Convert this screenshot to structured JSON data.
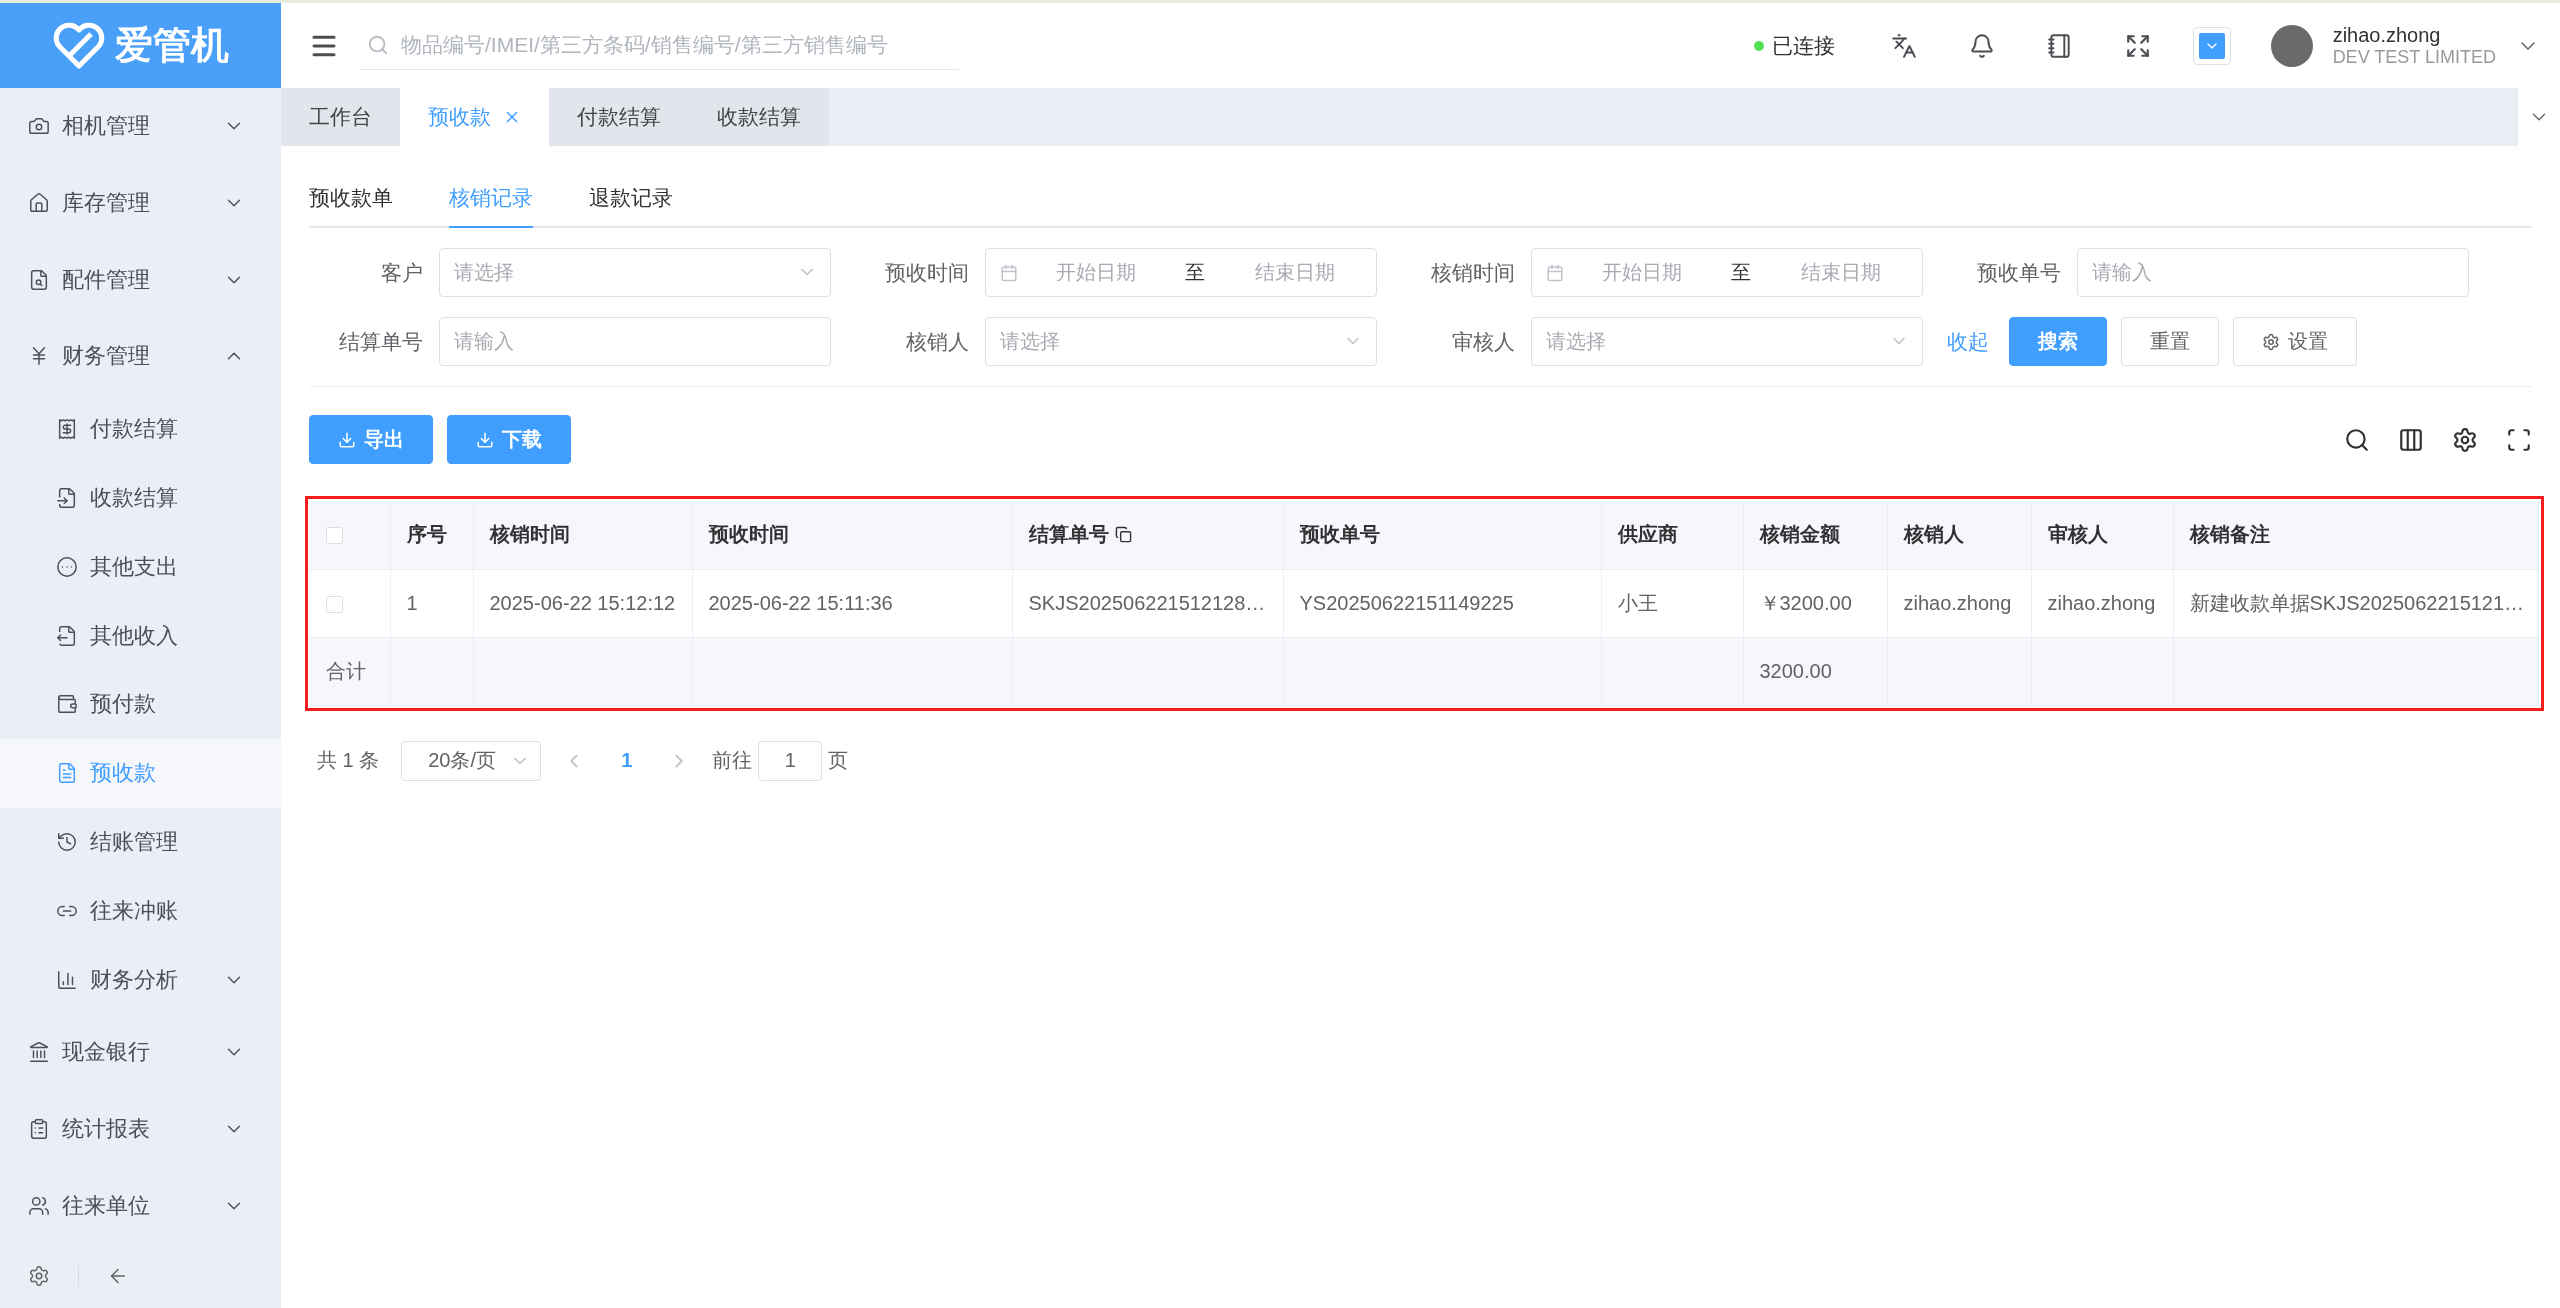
{
  "brand": {
    "name": "爱管机"
  },
  "search": {
    "placeholder": "物品编号/IMEI/第三方条码/销售编号/第三方销售编号"
  },
  "connection": {
    "label": "已连接",
    "connected": true
  },
  "user": {
    "name": "zihao.zhong",
    "company": "DEV TEST LIMITED"
  },
  "page_tabs": [
    {
      "label": "工作台",
      "selected": false,
      "closable": false
    },
    {
      "label": "预收款",
      "selected": true,
      "closable": true
    },
    {
      "label": "付款结算",
      "selected": false,
      "closable": false
    },
    {
      "label": "收款结算",
      "selected": false,
      "closable": false
    }
  ],
  "sidebar": {
    "items": [
      {
        "label": "相机管理",
        "expanded": false
      },
      {
        "label": "库存管理",
        "expanded": false
      },
      {
        "label": "配件管理",
        "expanded": false
      },
      {
        "label": "财务管理",
        "expanded": true,
        "children": [
          {
            "label": "付款结算",
            "selected": false
          },
          {
            "label": "收款结算",
            "selected": false
          },
          {
            "label": "其他支出",
            "selected": false
          },
          {
            "label": "其他收入",
            "selected": false
          },
          {
            "label": "预付款",
            "selected": false
          },
          {
            "label": "预收款",
            "selected": true
          },
          {
            "label": "结账管理",
            "selected": false
          },
          {
            "label": "往来冲账",
            "selected": false
          },
          {
            "label": "财务分析",
            "selected": false,
            "expandable": true
          }
        ]
      },
      {
        "label": "现金银行",
        "expanded": false
      },
      {
        "label": "统计报表",
        "expanded": false
      },
      {
        "label": "往来单位",
        "expanded": false
      }
    ]
  },
  "sub_tabs": [
    {
      "label": "预收款单",
      "selected": false
    },
    {
      "label": "核销记录",
      "selected": true
    },
    {
      "label": "退款记录",
      "selected": false
    }
  ],
  "filters": [
    {
      "label": "客户",
      "kind": "select",
      "placeholder": "请选择"
    },
    {
      "label": "预收时间",
      "kind": "daterange",
      "start_placeholder": "开始日期",
      "separator": "至",
      "end_placeholder": "结束日期"
    },
    {
      "label": "核销时间",
      "kind": "daterange",
      "start_placeholder": "开始日期",
      "separator": "至",
      "end_placeholder": "结束日期"
    },
    {
      "label": "预收单号",
      "kind": "input",
      "placeholder": "请输入"
    },
    {
      "label": "结算单号",
      "kind": "input",
      "placeholder": "请输入"
    },
    {
      "label": "核销人",
      "kind": "select",
      "placeholder": "请选择"
    },
    {
      "label": "审核人",
      "kind": "select",
      "placeholder": "请选择"
    }
  ],
  "filter_actions": {
    "collapse_link": "收起",
    "buttons": [
      {
        "label": "搜索",
        "kind": "primary"
      },
      {
        "label": "重置",
        "kind": "plain"
      },
      {
        "label": "设置",
        "kind": "settings"
      }
    ]
  },
  "toolbar": {
    "buttons": [
      "导出",
      "下载"
    ]
  },
  "table": {
    "highlighted": true,
    "all_checked": false,
    "columns": [
      {
        "label": "序号"
      },
      {
        "label": "核销时间"
      },
      {
        "label": "预收时间"
      },
      {
        "label": "结算单号",
        "copy_icon": true
      },
      {
        "label": "预收单号"
      },
      {
        "label": "供应商"
      },
      {
        "label": "核销金额",
        "summed": true
      },
      {
        "label": "核销人"
      },
      {
        "label": "审核人"
      },
      {
        "label": "核销备注"
      }
    ],
    "rows": [
      {
        "checked": false,
        "cells": [
          "1",
          "2025-06-22 15:12:12",
          "2025-06-22 15:11:36",
          "SKJS202506221512128…",
          "YS20250622151149225",
          "小王",
          "￥3200.00",
          "zihao.zhong",
          "zihao.zhong",
          "新建收款单据SKJS2025062215121…"
        ]
      }
    ],
    "summary": {
      "label": "合计",
      "total": "3200.00"
    }
  },
  "pagination": {
    "total": "共 1 条",
    "page_size": "20条/页",
    "pages": [
      {
        "label": "1",
        "selected": true
      }
    ],
    "goto_label": "前往",
    "goto_value": "1",
    "goto_suffix": "页"
  }
}
